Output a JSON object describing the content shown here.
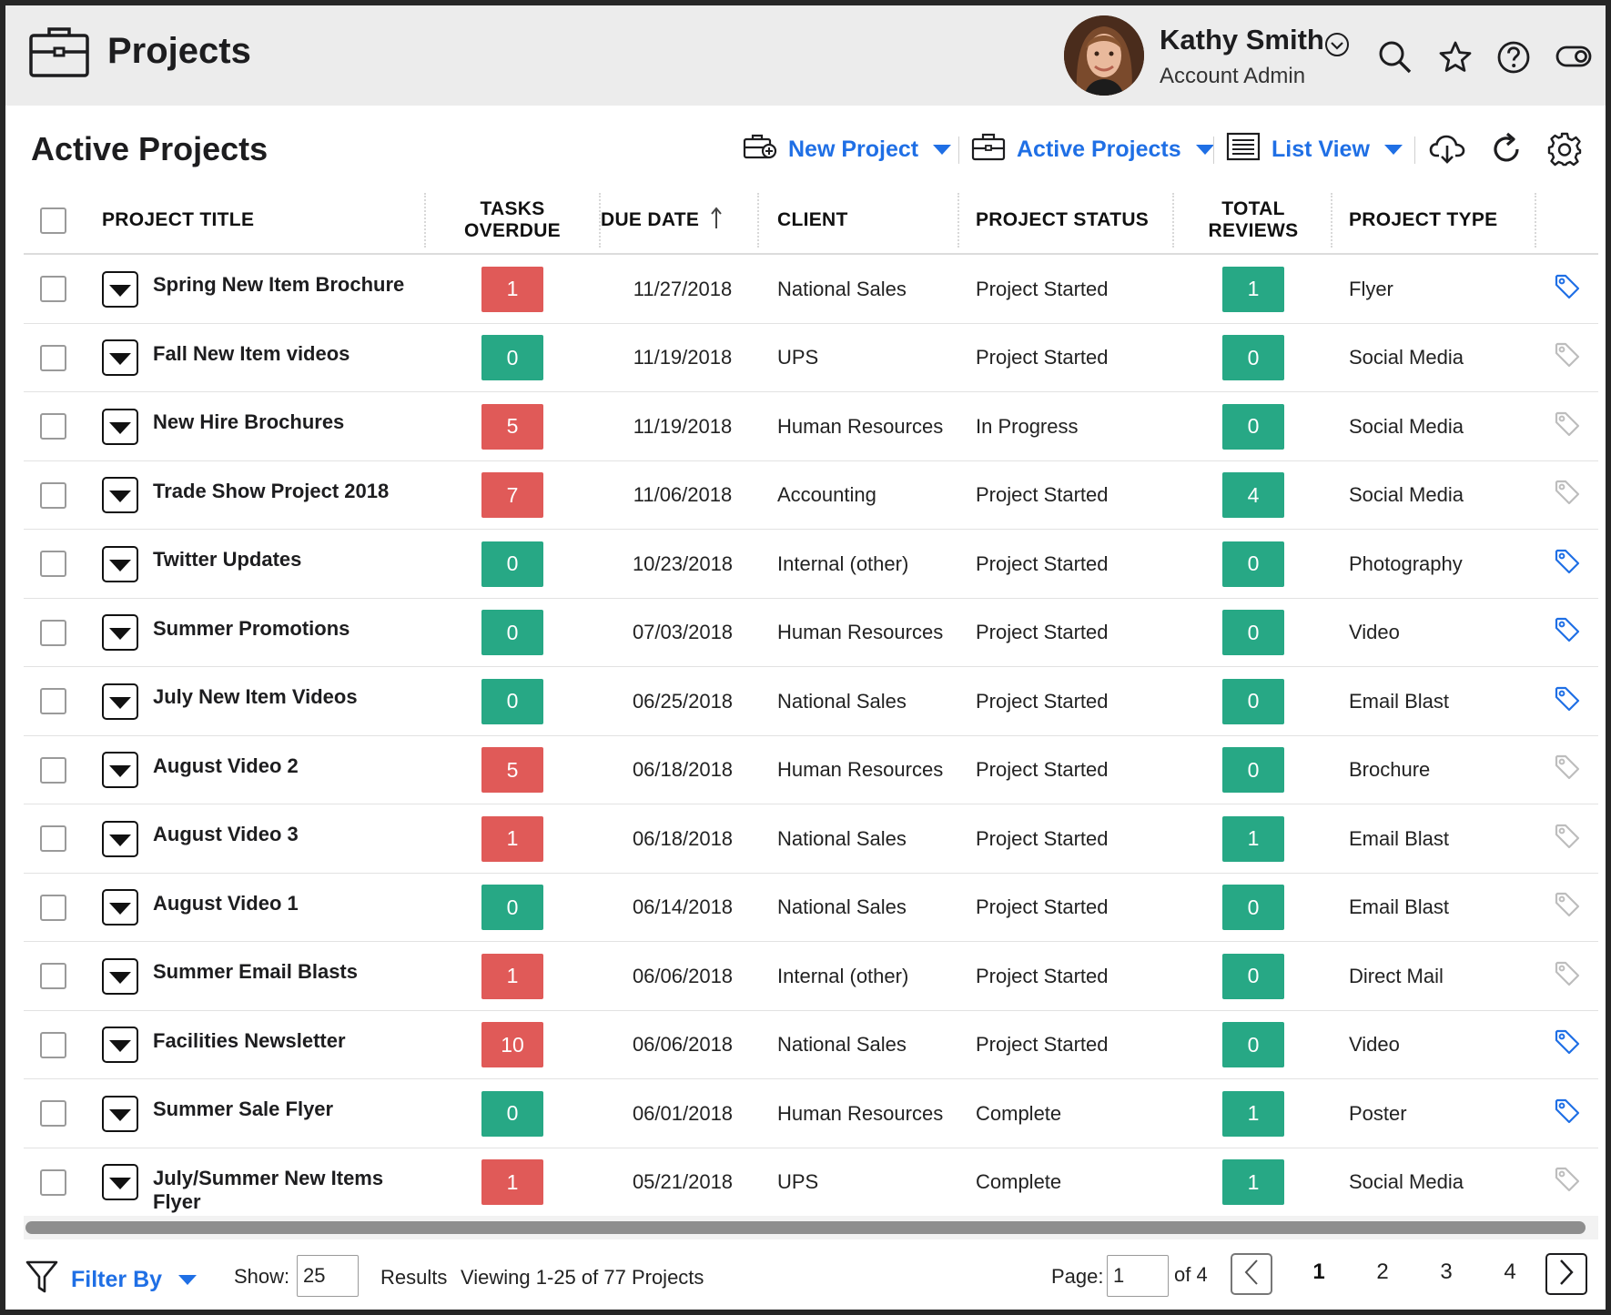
{
  "app": {
    "title": "Projects"
  },
  "user": {
    "name": "Kathy Smith",
    "role": "Account Admin"
  },
  "toolbar": {
    "page_title": "Active Projects",
    "new_project": "New Project",
    "active_projects": "Active Projects",
    "list_view": "List View"
  },
  "columns": {
    "title": "PROJECT TITLE",
    "tasks_overdue": "TASKS OVERDUE",
    "due_date": "DUE DATE",
    "client": "CLIENT",
    "status": "PROJECT STATUS",
    "reviews": "TOTAL REVIEWS",
    "type": "PROJECT TYPE"
  },
  "colors": {
    "accent": "#1f6fe5",
    "overdue": "#e05a58",
    "ok": "#27a885",
    "tag_active": "#1f6fe5",
    "tag_inactive": "#bdbdbd"
  },
  "rows": [
    {
      "title": "Spring New Item Brochure",
      "overdue": "1",
      "due": "11/27/2018",
      "client": "National Sales",
      "status": "Project Started",
      "reviews": "1",
      "type": "Flyer",
      "tag_active": true
    },
    {
      "title": "Fall New Item videos",
      "overdue": "0",
      "due": "11/19/2018",
      "client": "UPS",
      "status": "Project Started",
      "reviews": "0",
      "type": "Social Media",
      "tag_active": false
    },
    {
      "title": "New Hire Brochures",
      "overdue": "5",
      "due": "11/19/2018",
      "client": "Human Resources",
      "status": "In Progress",
      "reviews": "0",
      "type": "Social Media",
      "tag_active": false
    },
    {
      "title": "Trade Show Project 2018",
      "overdue": "7",
      "due": "11/06/2018",
      "client": "Accounting",
      "status": "Project Started",
      "reviews": "4",
      "type": "Social Media",
      "tag_active": false
    },
    {
      "title": "Twitter Updates",
      "overdue": "0",
      "due": "10/23/2018",
      "client": "Internal (other)",
      "status": "Project Started",
      "reviews": "0",
      "type": "Photography",
      "tag_active": true
    },
    {
      "title": "Summer Promotions",
      "overdue": "0",
      "due": "07/03/2018",
      "client": "Human Resources",
      "status": "Project Started",
      "reviews": "0",
      "type": "Video",
      "tag_active": true
    },
    {
      "title": "July New Item Videos",
      "overdue": "0",
      "due": "06/25/2018",
      "client": "National Sales",
      "status": "Project Started",
      "reviews": "0",
      "type": "Email Blast",
      "tag_active": true
    },
    {
      "title": "August Video 2",
      "overdue": "5",
      "due": "06/18/2018",
      "client": "Human Resources",
      "status": "Project Started",
      "reviews": "0",
      "type": "Brochure",
      "tag_active": false
    },
    {
      "title": "August Video 3",
      "overdue": "1",
      "due": "06/18/2018",
      "client": "National Sales",
      "status": "Project Started",
      "reviews": "1",
      "type": "Email Blast",
      "tag_active": false
    },
    {
      "title": "August Video 1",
      "overdue": "0",
      "due": "06/14/2018",
      "client": "National Sales",
      "status": "Project Started",
      "reviews": "0",
      "type": "Email Blast",
      "tag_active": false
    },
    {
      "title": "Summer Email Blasts",
      "overdue": "1",
      "due": "06/06/2018",
      "client": "Internal (other)",
      "status": "Project Started",
      "reviews": "0",
      "type": "Direct Mail",
      "tag_active": false
    },
    {
      "title": "Facilities Newsletter",
      "overdue": "10",
      "due": "06/06/2018",
      "client": "National Sales",
      "status": "Project Started",
      "reviews": "0",
      "type": "Video",
      "tag_active": true
    },
    {
      "title": "Summer Sale Flyer",
      "overdue": "0",
      "due": "06/01/2018",
      "client": "Human Resources",
      "status": "Complete",
      "reviews": "1",
      "type": "Poster",
      "tag_active": true
    },
    {
      "title": "July/Summer New Items Flyer",
      "overdue": "1",
      "due": "05/21/2018",
      "client": "UPS",
      "status": "Complete",
      "reviews": "1",
      "type": "Social Media",
      "tag_active": false
    }
  ],
  "footer": {
    "filter_label": "Filter By",
    "show_label": "Show:",
    "show_value": "25",
    "results_label": "Results",
    "viewing_text": "Viewing 1-25 of 77 Projects",
    "page_label": "Page:",
    "page_value": "1",
    "of_pages": "of 4",
    "pages": [
      "1",
      "2",
      "3",
      "4"
    ],
    "current_page": "1"
  }
}
